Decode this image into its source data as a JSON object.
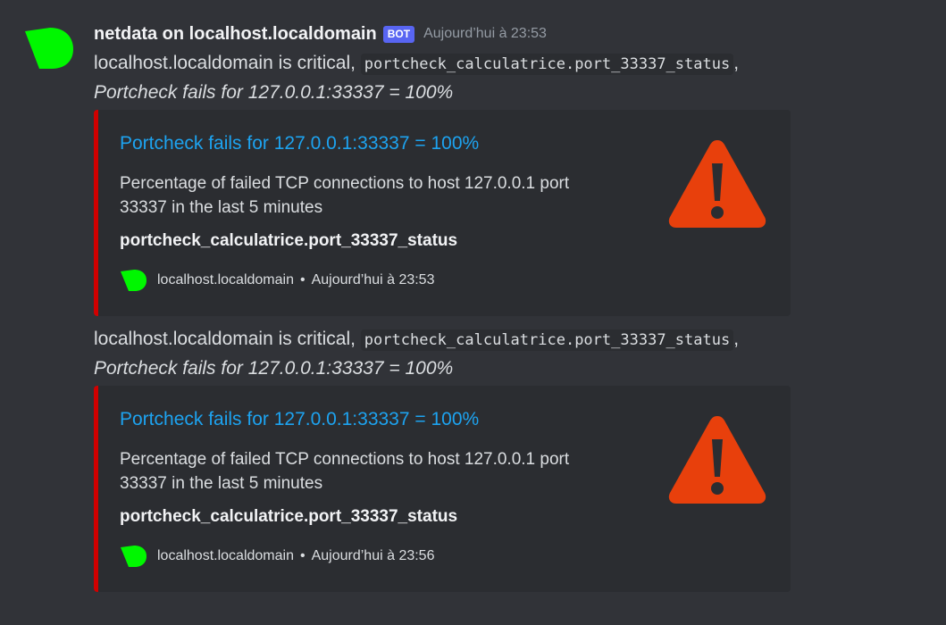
{
  "author": {
    "name": "netdata on localhost.localdomain",
    "bot_tag": "BOT",
    "timestamp": "Aujourd’hui à 23:53",
    "avatar_icon": "netdata-logo-icon",
    "avatar_color": "#00f700"
  },
  "messages": [
    {
      "text_prefix": "localhost.localdomain is critical, ",
      "code": "portcheck_calculatrice.port_33337_status",
      "text_suffix": ",",
      "emphasis": "Portcheck fails for 127.0.0.1:33337 = 100%",
      "embed": {
        "title": "Portcheck fails for 127.0.0.1:33337 = 100%",
        "description": "Percentage of failed TCP connections to host 127.0.0.1 port 33337 in the last 5 minutes",
        "field": "portcheck_calculatrice.port_33337_status",
        "footer_host": "localhost.localdomain",
        "footer_sep": "•",
        "footer_time": "Aujourd’hui à 23:53",
        "thumbnail_icon": "warning-triangle-icon",
        "accent_color": "#d10000"
      }
    },
    {
      "text_prefix": "localhost.localdomain is critical, ",
      "code": "portcheck_calculatrice.port_33337_status",
      "text_suffix": ",",
      "emphasis": "Portcheck fails for 127.0.0.1:33337 = 100%",
      "embed": {
        "title": "Portcheck fails for 127.0.0.1:33337 = 100%",
        "description": "Percentage of failed TCP connections to host 127.0.0.1 port 33337 in the last 5 minutes",
        "field": "portcheck_calculatrice.port_33337_status",
        "footer_host": "localhost.localdomain",
        "footer_sep": "•",
        "footer_time": "Aujourd’hui à 23:56",
        "thumbnail_icon": "warning-triangle-icon",
        "accent_color": "#d10000"
      }
    }
  ],
  "colors": {
    "background": "#313338",
    "embed_background": "#2b2d31",
    "link": "#1da3f0",
    "warning": "#e8400c",
    "bot_tag": "#5865f2"
  }
}
